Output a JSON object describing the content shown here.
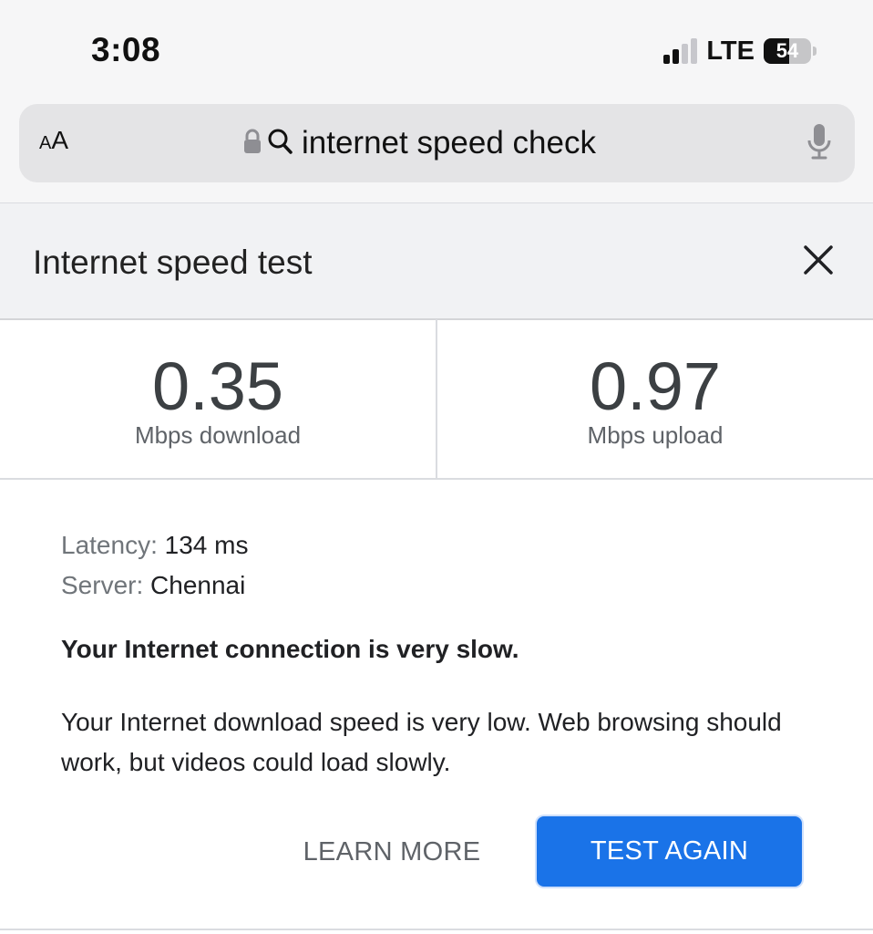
{
  "status_bar": {
    "time": "3:08",
    "network": "LTE",
    "battery_level": "54",
    "battery_fraction": 0.54,
    "signal_bars_active": 2,
    "signal_bars_total": 4
  },
  "browser": {
    "text_size_button": {
      "small": "A",
      "large": "A"
    },
    "search_query": "internet speed check",
    "icons": [
      "lock-icon",
      "search-icon",
      "microphone-icon"
    ]
  },
  "speed_test": {
    "title": "Internet speed test",
    "download": {
      "value": "0.35",
      "unit_label": "Mbps download"
    },
    "upload": {
      "value": "0.97",
      "unit_label": "Mbps upload"
    },
    "latency": {
      "label": "Latency:",
      "value": "134 ms"
    },
    "server": {
      "label": "Server:",
      "value": "Chennai"
    },
    "headline": "Your Internet connection is very slow.",
    "description": "Your Internet download speed is very low. Web browsing should work, but videos could load slowly.",
    "learn_more_label": "LEARN MORE",
    "test_again_label": "TEST AGAIN"
  },
  "colors": {
    "accent_blue": "#1a73e8",
    "header_bg": "#f1f2f4",
    "result_number": "#3c4043"
  }
}
